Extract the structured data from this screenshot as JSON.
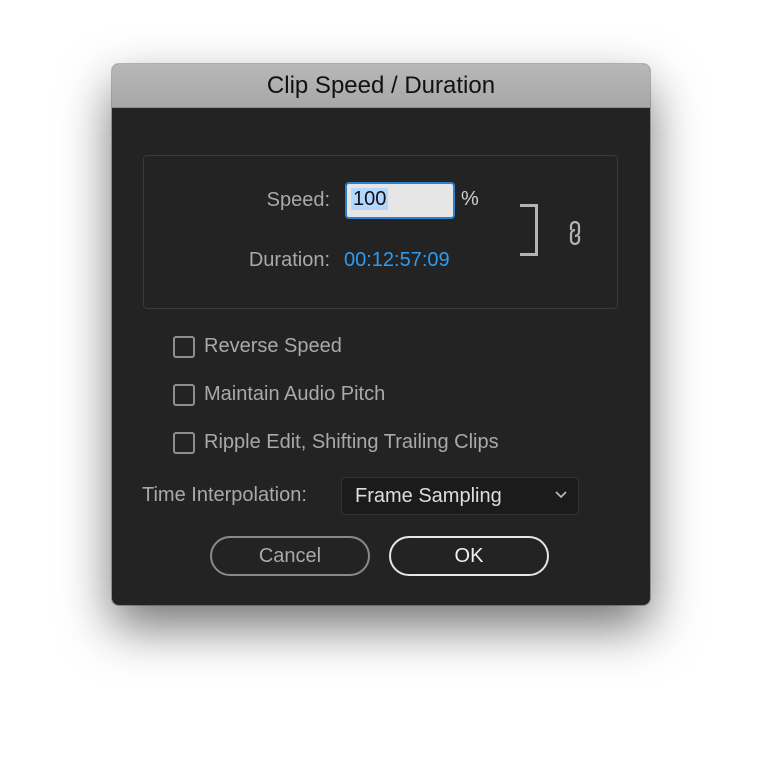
{
  "dialog": {
    "title": "Clip Speed / Duration",
    "speed": {
      "label": "Speed:",
      "value": "100",
      "unit": "%"
    },
    "duration": {
      "label": "Duration:",
      "value": "00:12:57:09"
    },
    "link_icon": "chain-link-icon",
    "checkboxes": [
      {
        "label": "Reverse Speed",
        "checked": false
      },
      {
        "label": "Maintain Audio Pitch",
        "checked": false
      },
      {
        "label": "Ripple Edit, Shifting Trailing Clips",
        "checked": false
      }
    ],
    "time_interpolation": {
      "label": "Time Interpolation:",
      "selected": "Frame Sampling"
    },
    "buttons": {
      "cancel": "Cancel",
      "ok": "OK"
    },
    "colors": {
      "accent": "#2e9bf0",
      "focus_border": "#2d7fd6",
      "background": "#232323"
    }
  }
}
